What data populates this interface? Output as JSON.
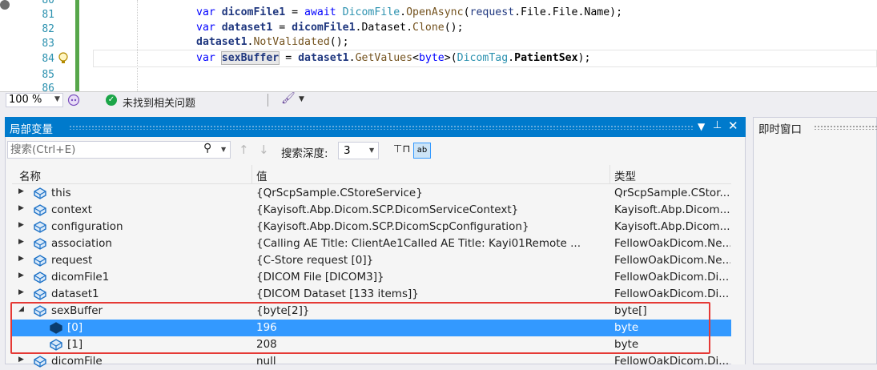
{
  "editor": {
    "line_numbers": [
      "80",
      "81",
      "82",
      "83",
      "84",
      "85",
      "86"
    ],
    "lines": [
      {
        "parts": [
          [
            "kw",
            "var "
          ],
          [
            "vr",
            "dicomFile1"
          ],
          [
            "",
            "  = "
          ],
          [
            "kw",
            "await "
          ],
          [
            "ty",
            "DicomFile"
          ],
          [
            "",
            "."
          ],
          [
            "me",
            "OpenAsync"
          ],
          [
            "",
            "(request.File.File.Name);"
          ]
        ]
      },
      {
        "parts": [
          [
            "kw",
            "var "
          ],
          [
            "vr",
            "dataset1"
          ],
          [
            "",
            ""
          ],
          [
            "",
            ""
          ],
          [
            "",
            ""
          ],
          [
            "",
            ""
          ],
          [
            "",
            ""
          ],
          [
            "",
            ""
          ]
        ]
      },
      {
        "parts": []
      },
      {
        "parts": []
      }
    ],
    "code_line_81": "var dicomFile1 = await DicomFile.OpenAsync(request.File.File.Name);",
    "code_line_82": "var dataset1 = dicomFile1.Dataset.Clone();",
    "code_line_83": "dataset1.NotValidated();",
    "code_line_84": "var sexBuffer = dataset1.GetValues<byte>(DicomTag.PatientSex);"
  },
  "status_bar": {
    "zoom": "100 %",
    "issues": "未找到相关问题"
  },
  "locals_panel": {
    "title": "局部变量",
    "search_placeholder": "搜索(Ctrl+E)",
    "depth_label": "搜索深度:",
    "depth_value": "3",
    "columns": {
      "name": "名称",
      "value": "值",
      "type": "类型"
    },
    "rows": [
      {
        "name": "this",
        "value": "{QrScpSample.CStoreService}",
        "type": "QrScpSample.CStor..."
      },
      {
        "name": "context",
        "value": "{Kayisoft.Abp.Dicom.SCP.DicomServiceContext}",
        "type": "Kayisoft.Abp.Dicom...."
      },
      {
        "name": "configuration",
        "value": "{Kayisoft.Abp.Dicom.SCP.DicomScpConfiguration}",
        "type": "Kayisoft.Abp.Dicom...."
      },
      {
        "name": "association",
        "value": "{Calling AE Title:      ClientAe1Called AE Title:      Kayi01Remote ...",
        "type": "FellowOakDicom.Ne..."
      },
      {
        "name": "request",
        "value": "{C-Store request [0]}",
        "type": "FellowOakDicom.Ne..."
      },
      {
        "name": "dicomFile1",
        "value": "{DICOM File [DICOM3]}",
        "type": "FellowOakDicom.Di..."
      },
      {
        "name": "dataset1",
        "value": "{DICOM Dataset [133 items]}",
        "type": "FellowOakDicom.Di..."
      },
      {
        "name": "sexBuffer",
        "value": "{byte[2]}",
        "type": "byte[]"
      },
      {
        "name": "[0]",
        "value": "196",
        "type": "byte"
      },
      {
        "name": "[1]",
        "value": "208",
        "type": "byte"
      },
      {
        "name": "dicomFile",
        "value": "null",
        "type": "FellowOakDicom.Di..."
      }
    ]
  },
  "immediate_window": {
    "title": "即时窗口"
  },
  "colors": {
    "accent": "#007acc",
    "selection": "#3399ff",
    "highlight_box": "#e53935"
  }
}
